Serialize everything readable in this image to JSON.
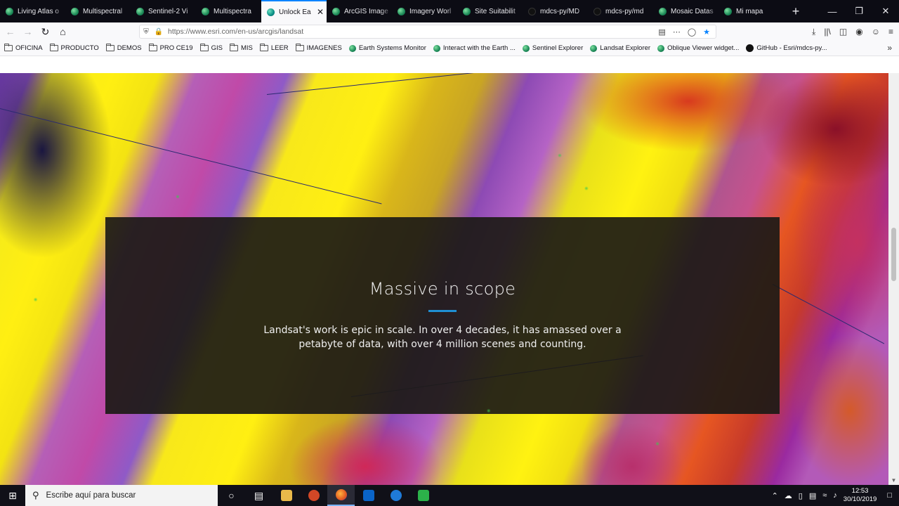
{
  "tabs": [
    {
      "label": "Living Atlas o",
      "icon": "globe-icon",
      "active": false
    },
    {
      "label": "Multispectral",
      "icon": "globe-icon",
      "active": false
    },
    {
      "label": "Sentinel-2 Vi",
      "icon": "globe-icon",
      "active": false
    },
    {
      "label": "Multispectra",
      "icon": "globe-icon",
      "active": false
    },
    {
      "label": "Unlock Ea",
      "icon": "esri-icon",
      "active": true
    },
    {
      "label": "ArcGIS Image",
      "icon": "globe-icon",
      "active": false
    },
    {
      "label": "Imagery Worl",
      "icon": "globe-icon",
      "active": false
    },
    {
      "label": "Site Suitabilit",
      "icon": "globe-icon",
      "active": false
    },
    {
      "label": "mdcs-py/MD",
      "icon": "github-icon",
      "active": false
    },
    {
      "label": "mdcs-py/md",
      "icon": "github-icon",
      "active": false
    },
    {
      "label": "Mosaic Datas",
      "icon": "globe-icon",
      "active": false
    },
    {
      "label": "Mi mapa",
      "icon": "globe-icon",
      "active": false
    }
  ],
  "address": {
    "url": "https://www.esri.com/en-us/arcgis/landsat"
  },
  "bookmarks": [
    {
      "label": "OFICINA",
      "type": "folder"
    },
    {
      "label": "PRODUCTO",
      "type": "folder"
    },
    {
      "label": "DEMOS",
      "type": "folder"
    },
    {
      "label": "PRO CE19",
      "type": "folder"
    },
    {
      "label": "GIS",
      "type": "folder"
    },
    {
      "label": "MIS",
      "type": "folder"
    },
    {
      "label": "LEER",
      "type": "folder"
    },
    {
      "label": "IMAGENES",
      "type": "folder"
    },
    {
      "label": "Earth Systems Monitor",
      "type": "globe"
    },
    {
      "label": "Interact with the Earth ...",
      "type": "globe"
    },
    {
      "label": "Sentinel Explorer",
      "type": "globe"
    },
    {
      "label": "Landsat Explorer",
      "type": "globe"
    },
    {
      "label": "Oblique Viewer widget...",
      "type": "globe"
    },
    {
      "label": "GitHub - Esri/mdcs-py...",
      "type": "github"
    }
  ],
  "panel": {
    "title": "Massive in scope",
    "body": "Landsat's work is epic in scale. In over 4 decades, it has amassed over a petabyte of data, with over 4 million scenes and counting."
  },
  "taskbar": {
    "search_placeholder": "Escribe aquí para buscar",
    "time": "12:53",
    "date": "30/10/2019"
  },
  "colors": {
    "accent_rule": "#1f8fd4",
    "active_tab_indicator": "#0a84ff",
    "panel_bg": "#1c1a16"
  }
}
